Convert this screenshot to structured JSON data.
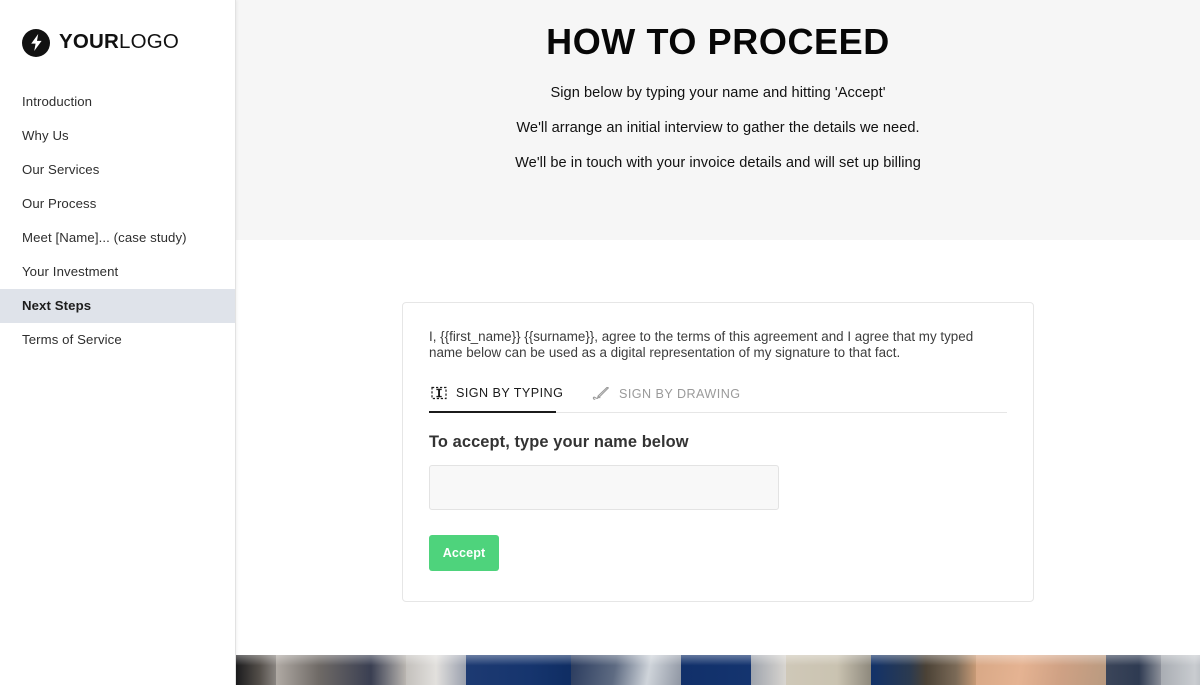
{
  "sidebar": {
    "logo": {
      "icon": "lightning-bolt-icon",
      "text_bold": "YOUR",
      "text_light": "LOGO"
    },
    "items": [
      {
        "label": "Introduction",
        "active": false
      },
      {
        "label": "Why Us",
        "active": false
      },
      {
        "label": "Our Services",
        "active": false
      },
      {
        "label": "Our Process",
        "active": false
      },
      {
        "label": "Meet [Name]... (case study)",
        "active": false
      },
      {
        "label": "Your Investment",
        "active": false
      },
      {
        "label": "Next Steps",
        "active": true
      },
      {
        "label": "Terms of Service",
        "active": false
      }
    ]
  },
  "hero": {
    "title": "HOW TO PROCEED",
    "line1": "Sign below by typing your name and hitting 'Accept'",
    "line2": "We'll arrange an initial interview to gather the details we need.",
    "line3": "We'll be in touch with your invoice details and will set up billing",
    "background": "#f6f6f6"
  },
  "signature_card": {
    "consent_text": "I, {{first_name}} {{surname}}, agree to the terms of this agreement and I agree that my typed name below can be used as a digital representation of my signature to that fact.",
    "tabs": [
      {
        "label": "SIGN BY TYPING",
        "icon": "text-cursor-icon",
        "active": true
      },
      {
        "label": "SIGN BY DRAWING",
        "icon": "pen-nib-icon",
        "active": false
      }
    ],
    "field_label": "To accept, type your name below",
    "name_input": {
      "value": "",
      "placeholder": ""
    },
    "accept_button": {
      "label": "Accept",
      "color": "#4ed37c"
    }
  },
  "colors": {
    "sidebar_active_bg": "#dfe3ea",
    "hero_bg": "#f6f6f6",
    "accent_green": "#4ed37c",
    "text_dark": "#111111"
  }
}
